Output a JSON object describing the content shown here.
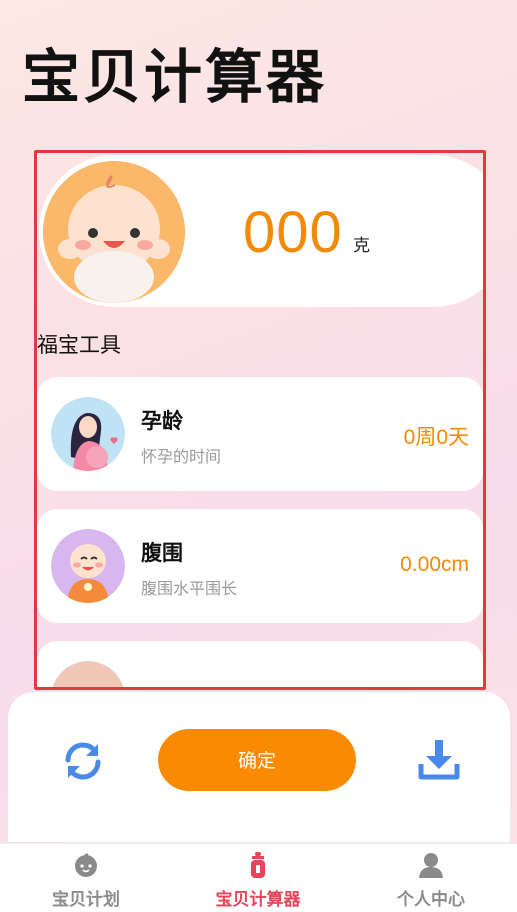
{
  "app_title": "宝贝计算器",
  "weight": {
    "value": "000",
    "unit": "克"
  },
  "section_title": "福宝工具",
  "tools": [
    {
      "name": "孕龄",
      "desc": "怀孕的时间",
      "value": "0周0天"
    },
    {
      "name": "腹围",
      "desc": "腹围水平围长",
      "value": "0.00cm"
    }
  ],
  "actions": {
    "confirm_label": "确定"
  },
  "tabs": [
    {
      "label": "宝贝计划",
      "active": false
    },
    {
      "label": "宝贝计算器",
      "active": true
    },
    {
      "label": "个人中心",
      "active": false
    }
  ],
  "colors": {
    "accent": "#fb8a03",
    "active_tab": "#e8435a",
    "inactive_tab": "#8a8a8a",
    "icon_blue": "#4b89e8",
    "frame": "#e0393e"
  }
}
